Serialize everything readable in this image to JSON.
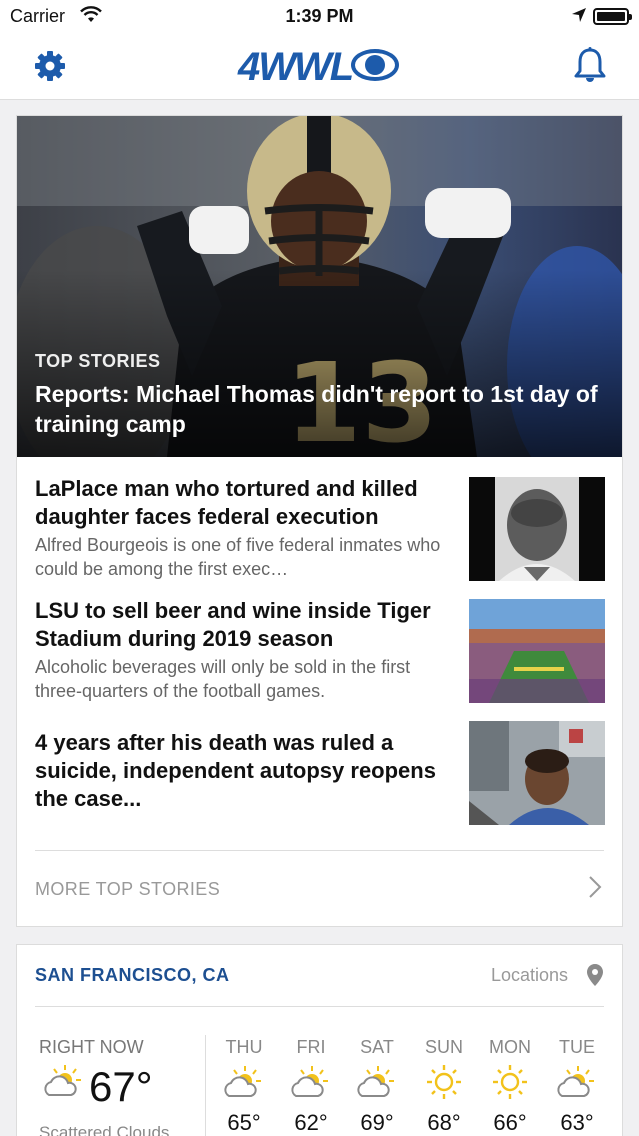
{
  "status": {
    "carrier": "Carrier",
    "time": "1:39 PM"
  },
  "header": {
    "logo_text": "4WWL"
  },
  "top_story": {
    "kicker": "TOP STORIES",
    "title": "Reports: Michael Thomas didn't report to 1st day of training camp",
    "jersey_number": "13"
  },
  "stories": [
    {
      "headline": "LaPlace man who tortured and killed daughter faces federal execution",
      "summary": "Alfred Bourgeois is one of five federal inmates who could be among the first exec…"
    },
    {
      "headline": "LSU to sell beer and wine inside Tiger Stadium during 2019 season",
      "summary": "Alcoholic beverages will only be sold in the first three-quarters of the football games."
    },
    {
      "headline": "4 years after his death was ruled a suicide, independent autopsy reopens the case...",
      "summary": ""
    }
  ],
  "more_label": "MORE TOP STORIES",
  "weather": {
    "city": "SAN FRANCISCO, CA",
    "locations_label": "Locations",
    "now_label": "RIGHT NOW",
    "now_temp": "67°",
    "now_condition": "Scattered Clouds",
    "now_icon": "partly-cloudy-icon",
    "days": [
      {
        "name": "THU",
        "temp": "65°",
        "icon": "partly-cloudy-icon"
      },
      {
        "name": "FRI",
        "temp": "62°",
        "icon": "partly-cloudy-icon"
      },
      {
        "name": "SAT",
        "temp": "69°",
        "icon": "partly-cloudy-icon"
      },
      {
        "name": "SUN",
        "temp": "68°",
        "icon": "sun-icon"
      },
      {
        "name": "MON",
        "temp": "66°",
        "icon": "sun-icon"
      },
      {
        "name": "TUE",
        "temp": "63°",
        "icon": "partly-cloudy-icon"
      }
    ]
  },
  "colors": {
    "brand": "#1d5bab",
    "city": "#1d4f91",
    "sun": "#f2c21b"
  }
}
